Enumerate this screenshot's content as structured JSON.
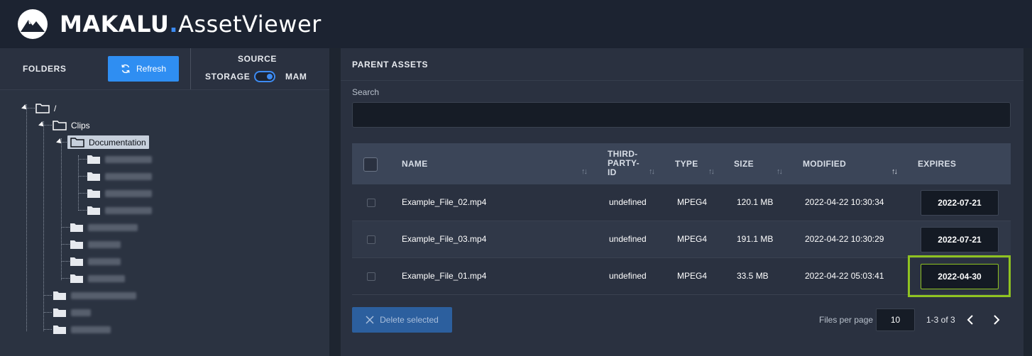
{
  "app": {
    "brand": "MAKALU",
    "dot": ".",
    "product": "AssetViewer",
    "accent": "#3d8bf2"
  },
  "left": {
    "folders_label": "FOLDERS",
    "refresh_label": "Refresh",
    "source_label": "SOURCE",
    "storage_label": "STORAGE",
    "mam_label": "MAM",
    "toggle_state": "MAM",
    "tree": {
      "root": "/",
      "clips": "Clips",
      "documentation": "Documentation"
    }
  },
  "right": {
    "title": "PARENT ASSETS",
    "search_label": "Search",
    "search_value": "",
    "columns": {
      "name": "NAME",
      "third1": "THIRD-",
      "third2": "PARTY-",
      "third3": "ID",
      "type": "TYPE",
      "size": "SIZE",
      "modified": "MODIFIED",
      "expires": "EXPIRES"
    },
    "rows": [
      {
        "name": "Example_File_02.mp4",
        "third_party_id": "undefined",
        "type": "MPEG4",
        "size": "120.1 MB",
        "modified": "2022-04-22 10:30:34",
        "expires": "2022-07-21"
      },
      {
        "name": "Example_File_03.mp4",
        "third_party_id": "undefined",
        "type": "MPEG4",
        "size": "191.1 MB",
        "modified": "2022-04-22 10:30:29",
        "expires": "2022-07-21"
      },
      {
        "name": "Example_File_01.mp4",
        "third_party_id": "undefined",
        "type": "MPEG4",
        "size": "33.5 MB",
        "modified": "2022-04-22 05:03:41",
        "expires": "2022-04-30"
      }
    ],
    "delete_label": "Delete selected",
    "files_per_page_label": "Files per page",
    "files_per_page_value": "10",
    "page_info": "1-3 of 3"
  },
  "icons": {
    "logo": "mountain-logo-icon",
    "refresh": "refresh-icon",
    "delete": "close-icon",
    "prev": "chevron-left-icon",
    "next": "chevron-right-icon",
    "folder": "folder-icon"
  },
  "colors": {
    "highlight": "#8fc321",
    "primary_button": "#2f8ef2"
  }
}
